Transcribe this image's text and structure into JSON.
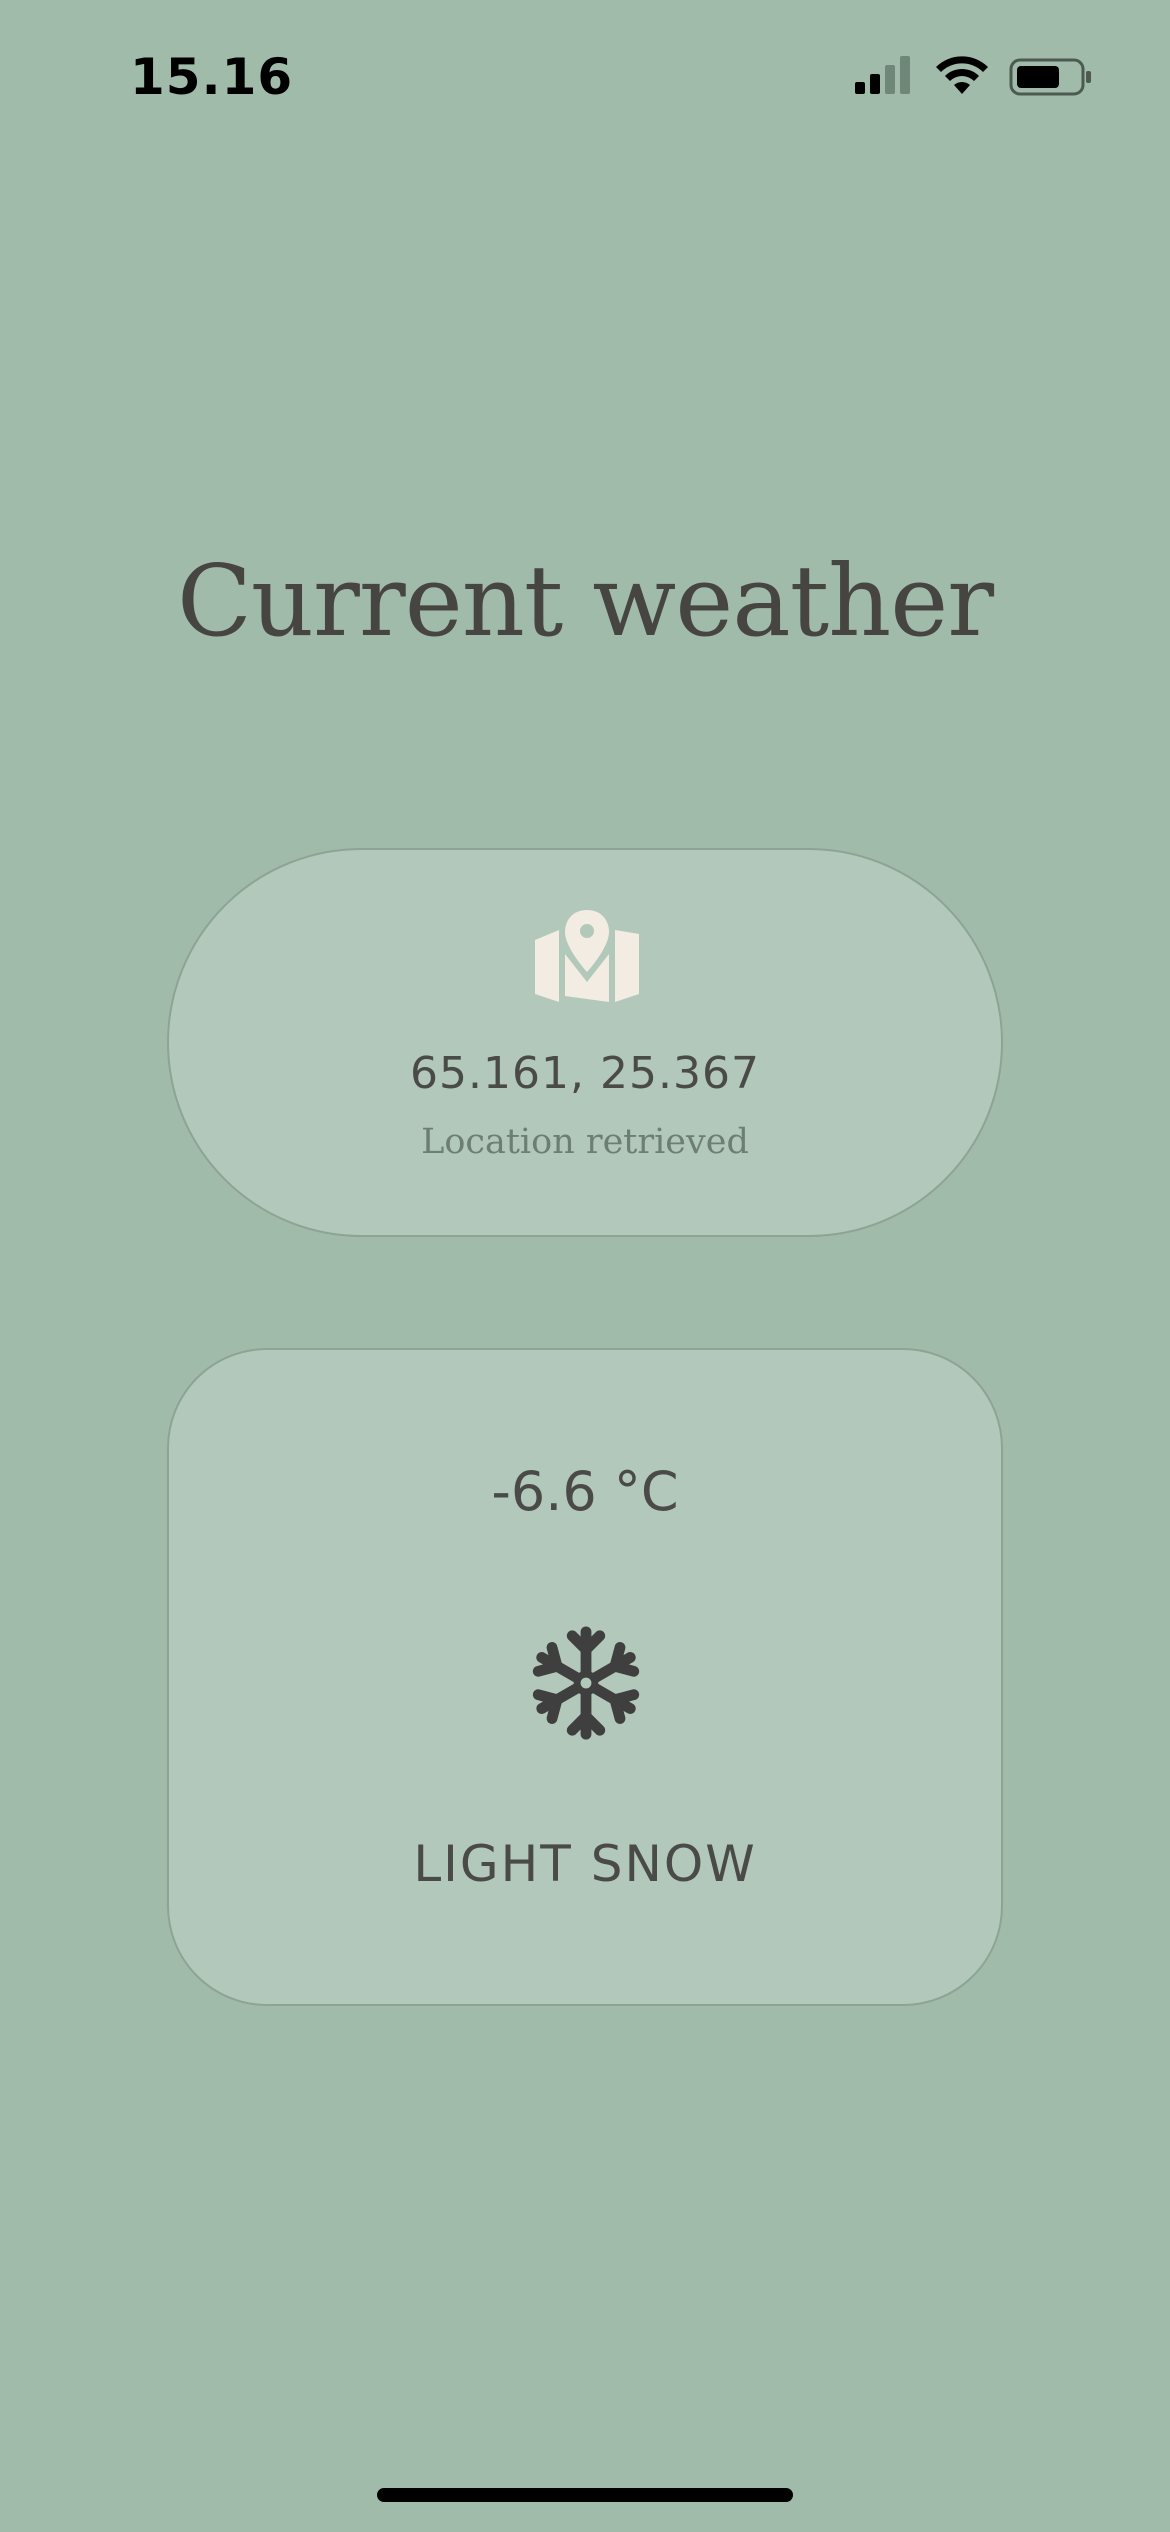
{
  "status_bar": {
    "time": "15.16",
    "icons": [
      "signal-icon",
      "wifi-icon",
      "battery-icon"
    ]
  },
  "page": {
    "title": "Current weather"
  },
  "location": {
    "icon": "map-pin-icon",
    "coordinates": "65.161, 25.367",
    "status": "Location retrieved"
  },
  "weather": {
    "temperature": "-6.6 °C",
    "icon": "snowflake-icon",
    "condition": "LIGHT SNOW"
  },
  "colors": {
    "background": "#a1bbaa",
    "card": "#b2c8bb",
    "card_border": "#8da494",
    "text": "#464542",
    "map_icon": "#f3ece3"
  }
}
